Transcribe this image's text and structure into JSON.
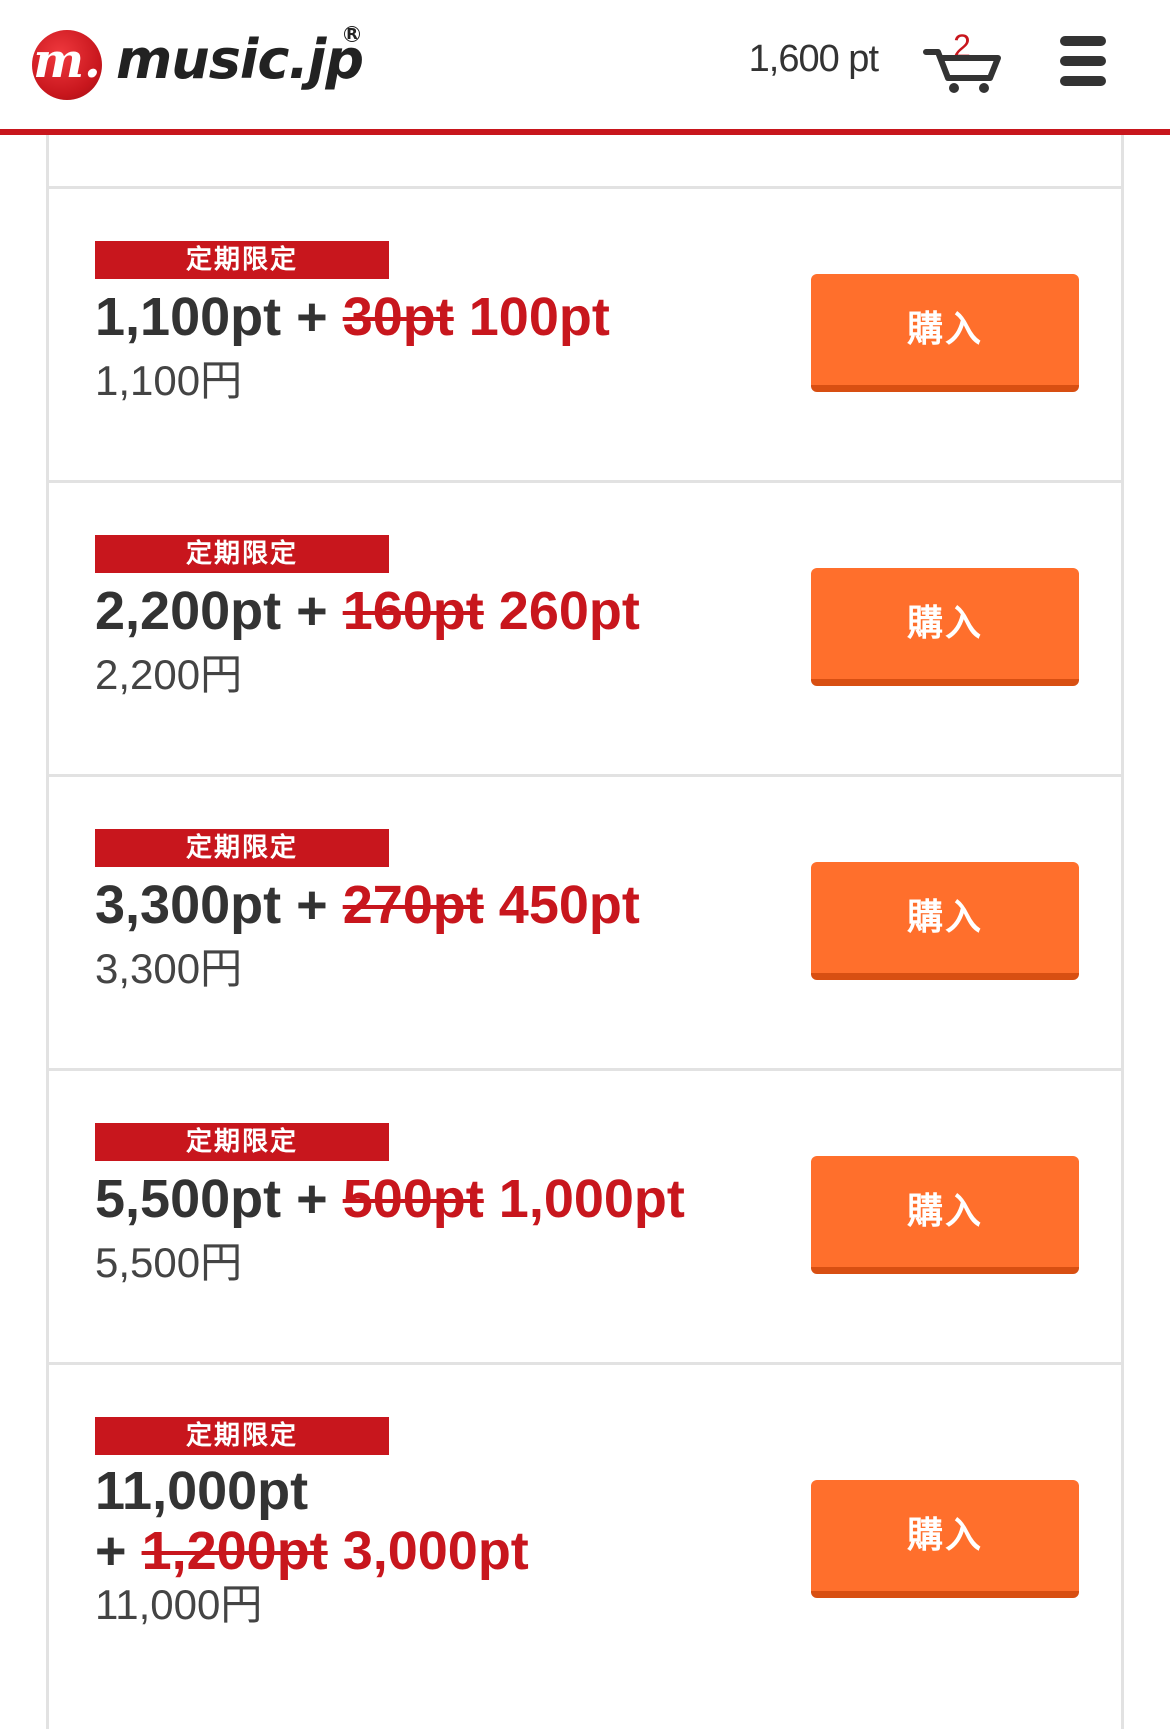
{
  "header": {
    "logo_mark": "m.",
    "logo_text": "music.jp",
    "logo_reg": "R",
    "points": "1,600 pt",
    "cart_count": "2"
  },
  "plans": [
    {
      "badge": "定期限定",
      "base": "1,100pt",
      "plus": "+",
      "old_bonus": "30pt",
      "new_bonus": "100pt",
      "price": "1,100円",
      "buy_label": "購入"
    },
    {
      "badge": "定期限定",
      "base": "2,200pt",
      "plus": "+",
      "old_bonus": "160pt",
      "new_bonus": "260pt",
      "price": "2,200円",
      "buy_label": "購入"
    },
    {
      "badge": "定期限定",
      "base": "3,300pt",
      "plus": "+",
      "old_bonus": "270pt",
      "new_bonus": "450pt",
      "price": "3,300円",
      "buy_label": "購入"
    },
    {
      "badge": "定期限定",
      "base": "5,500pt",
      "plus": "+",
      "old_bonus": "500pt",
      "new_bonus": "1,000pt",
      "price": "5,500円",
      "buy_label": "購入"
    },
    {
      "badge": "定期限定",
      "base": "11,000pt",
      "plus": "+",
      "old_bonus": "1,200pt",
      "new_bonus": "3,000pt",
      "price": "11,000円",
      "buy_label": "購入"
    }
  ],
  "colors": {
    "brand_red": "#c8161d",
    "buy_orange": "#ff6f2c",
    "buy_shadow": "#d84f12"
  },
  "icons": {
    "cart": "cart-icon",
    "menu": "hamburger-menu-icon",
    "logo": "music-jp-logo"
  }
}
